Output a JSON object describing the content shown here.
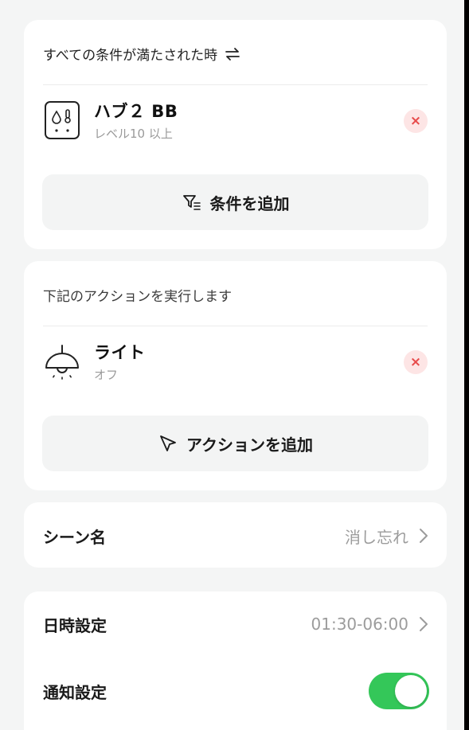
{
  "condition_card": {
    "header": "すべての条件が満たされた時",
    "header_icon": "swap-icon",
    "item": {
      "icon": "hub-device-icon",
      "title": "ハブ２ BB",
      "subtitle": "レベル10 以上",
      "remove_label": "×"
    },
    "add_button": {
      "icon": "filter-icon",
      "label": "条件を追加"
    }
  },
  "action_card": {
    "header": "下記のアクションを実行します",
    "item": {
      "icon": "ceiling-light-icon",
      "title": "ライト",
      "subtitle": "オフ",
      "remove_label": "×"
    },
    "add_button": {
      "icon": "send-icon",
      "label": "アクションを追加"
    }
  },
  "scene": {
    "label": "シーン名",
    "value": "消し忘れ"
  },
  "settings": {
    "time": {
      "label": "日時設定",
      "value": "01:30-06:00"
    },
    "notify": {
      "label": "通知設定",
      "enabled": true
    }
  },
  "colors": {
    "toggle_on": "#34c759",
    "remove_bg": "#fde5e5",
    "remove_fg": "#e74a4a",
    "background": "#f4f5f5"
  }
}
